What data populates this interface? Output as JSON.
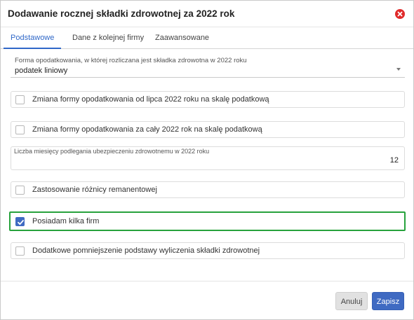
{
  "dialog": {
    "title": "Dodawanie rocznej składki zdrowotnej za 2022 rok"
  },
  "tabs": [
    {
      "label": "Podstawowe",
      "active": true
    },
    {
      "label": "Dane z kolejnej firmy",
      "active": false
    },
    {
      "label": "Zaawansowane",
      "active": false
    }
  ],
  "tax_form": {
    "label": "Forma opodatkowania, w której rozliczana jest składka zdrowotna w 2022 roku",
    "value": "podatek liniowy"
  },
  "checkbox_july": {
    "label": "Zmiana formy opodatkowania od lipca 2022 roku na skalę podatkową",
    "checked": false
  },
  "checkbox_year": {
    "label": "Zmiana formy opodatkowania za cały 2022 rok na skalę podatkową",
    "checked": false
  },
  "months": {
    "label": "Liczba miesięcy podlegania ubezpieczeniu zdrowotnemu w 2022 roku",
    "value": "12"
  },
  "checkbox_remanent": {
    "label": "Zastosowanie różnicy remanentowej",
    "checked": false
  },
  "checkbox_multiple": {
    "label": "Posiadam kilka firm",
    "checked": true
  },
  "checkbox_reduction": {
    "label": "Dodatkowe pomniejszenie podstawy wyliczenia składki zdrowotnej",
    "checked": false
  },
  "footer": {
    "cancel_label": "Anuluj",
    "save_label": "Zapisz"
  },
  "colors": {
    "accent": "#3f6ac2",
    "close": "#e02b2b",
    "highlight_border": "#27a23c"
  },
  "icons": {
    "close": "close-circle-icon",
    "dropdown": "chevron-down-icon",
    "check": "checkmark-icon"
  }
}
